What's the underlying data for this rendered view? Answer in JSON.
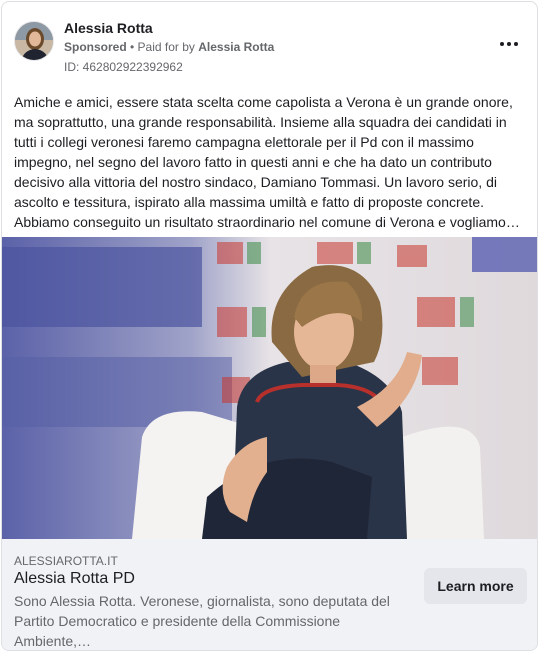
{
  "header": {
    "page_name": "Alessia Rotta",
    "sponsored": "Sponsored",
    "separator": " • ",
    "paid_for_prefix": "Paid for by ",
    "paid_for_name": "Alessia Rotta",
    "ad_id": "ID: 462802922392962",
    "more_icon": "more-horizontal-icon"
  },
  "post": {
    "text": "Amiche e amici, essere stata scelta come capolista a Verona è un grande onore, ma soprattutto, una grande responsabilità. Insieme alla squadra dei candidati in tutti i collegi veronesi faremo campagna elettorale per il Pd con il massimo impegno, nel segno del lavoro fatto in questi anni e che ha dato un contributo decisivo alla vittoria del nostro sindaco, Damiano Tommasi. Un lavoro serio, di ascolto e tessitura, ispirato alla massima umiltà e fatto di proposte concrete. Abbiamo conseguito un risultato straordinario nel comune di Verona e vogliamo…"
  },
  "link": {
    "domain": "ALESSIAROTTA.IT",
    "title": "Alessia Rotta PD",
    "description": "Sono Alessia Rotta. Veronese, giornalista, sono deputata del Partito Democratico e presidente della Commissione Ambiente,…",
    "cta_label": "Learn more"
  },
  "colors": {
    "text_primary": "#1c1e21",
    "text_secondary": "#65676b",
    "footer_bg": "#f0f2f5",
    "button_bg": "#e4e6eb",
    "border": "#dddfe2"
  }
}
